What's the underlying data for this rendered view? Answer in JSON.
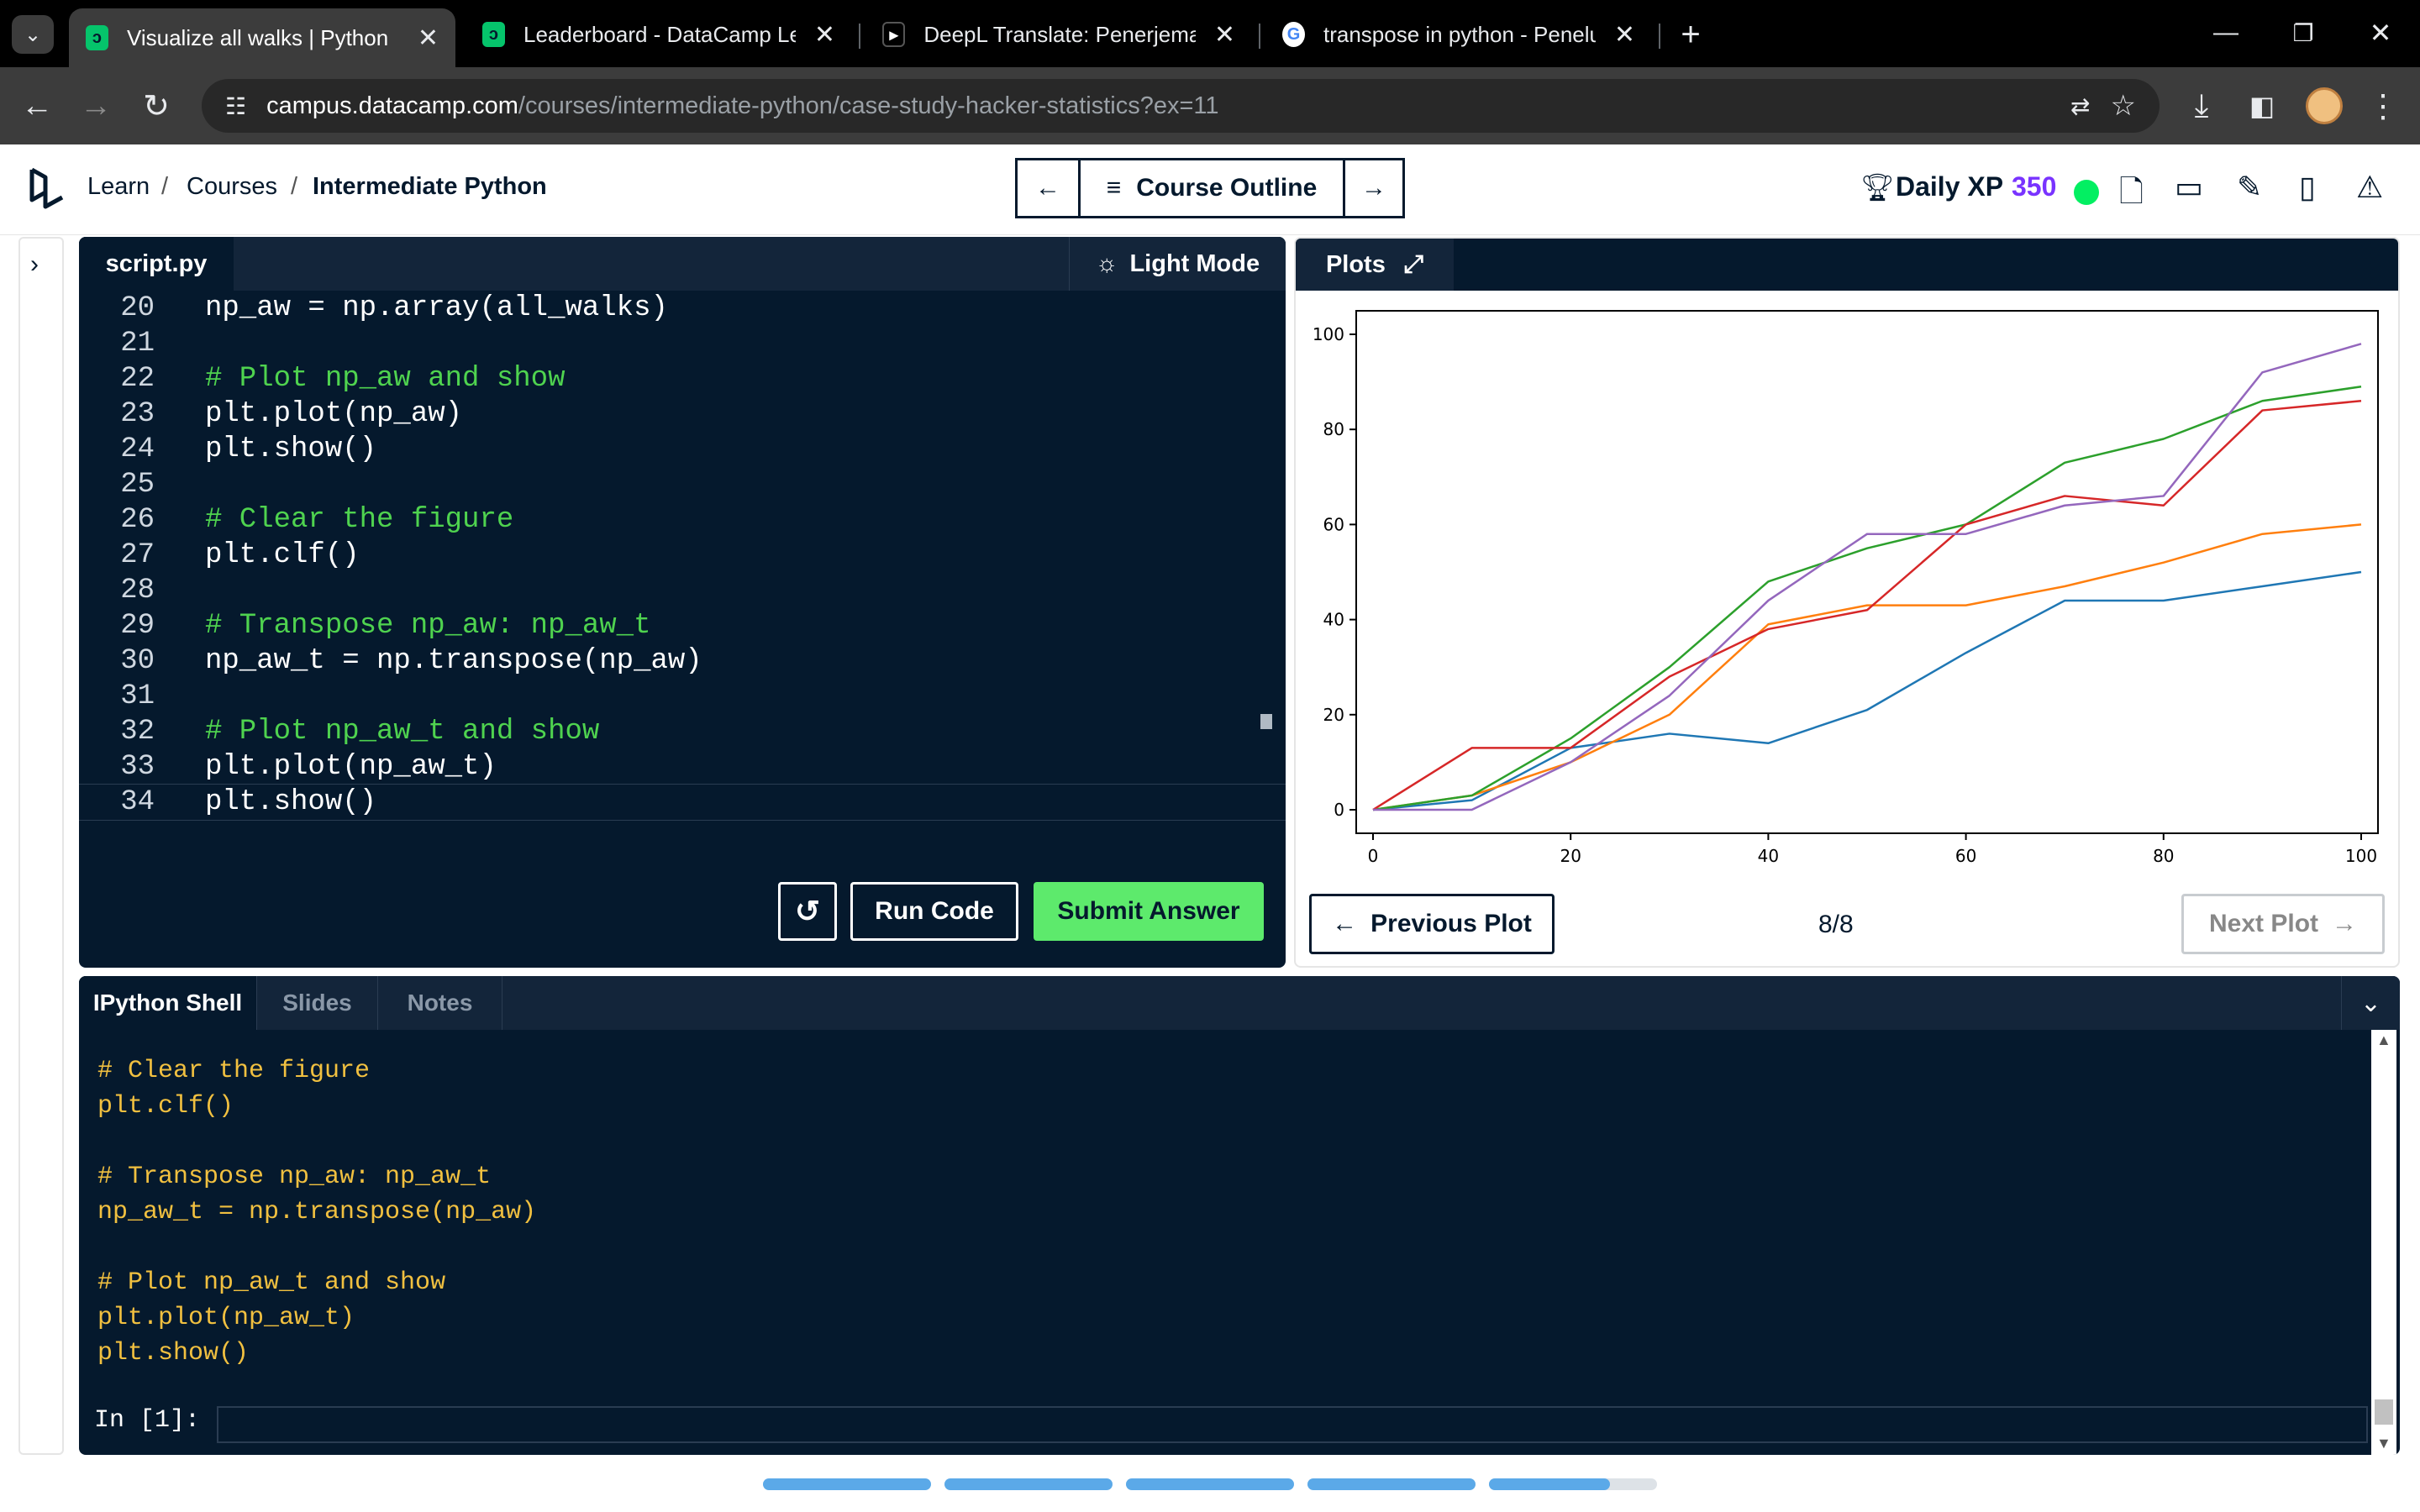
{
  "browser": {
    "tabs": [
      {
        "title": "Visualize all walks | Python",
        "favicon": "datacamp-icon",
        "active": true
      },
      {
        "title": "Leaderboard - DataCamp Learn",
        "favicon": "datacamp-icon",
        "active": false
      },
      {
        "title": "DeepL Translate: Penerjemah pa",
        "favicon": "deepl-icon",
        "active": false
      },
      {
        "title": "transpose in python - Penelusur",
        "favicon": "google-icon",
        "active": false
      }
    ],
    "url_host": "campus.datacamp.com",
    "url_path": "/courses/intermediate-python/case-study-hacker-statistics?ex=11"
  },
  "header": {
    "breadcrumb": [
      "Learn",
      "Courses",
      "Intermediate Python"
    ],
    "course_outline": "Course Outline",
    "daily_xp_label": "Daily XP",
    "daily_xp_value": "350"
  },
  "editor": {
    "filename": "script.py",
    "light_mode": "Light Mode",
    "lines": [
      {
        "n": "20",
        "text": "np_aw = np.array(all_walks)",
        "comment": false
      },
      {
        "n": "21",
        "text": "",
        "comment": false
      },
      {
        "n": "22",
        "text": "# Plot np_aw and show",
        "comment": true
      },
      {
        "n": "23",
        "text": "plt.plot(np_aw)",
        "comment": false
      },
      {
        "n": "24",
        "text": "plt.show()",
        "comment": false
      },
      {
        "n": "25",
        "text": "",
        "comment": false
      },
      {
        "n": "26",
        "text": "# Clear the figure",
        "comment": true
      },
      {
        "n": "27",
        "text": "plt.clf()",
        "comment": false
      },
      {
        "n": "28",
        "text": "",
        "comment": false
      },
      {
        "n": "29",
        "text": "# Transpose np_aw: np_aw_t",
        "comment": true
      },
      {
        "n": "30",
        "text": "np_aw_t = np.transpose(np_aw)",
        "comment": false
      },
      {
        "n": "31",
        "text": "",
        "comment": false
      },
      {
        "n": "32",
        "text": "# Plot np_aw_t and show",
        "comment": true
      },
      {
        "n": "33",
        "text": "plt.plot(np_aw_t)",
        "comment": false
      },
      {
        "n": "34",
        "text": "plt.show()",
        "comment": false
      }
    ],
    "run_code": "Run Code",
    "submit_answer": "Submit Answer"
  },
  "plots": {
    "tab_label": "Plots",
    "previous": "Previous Plot",
    "next": "Next Plot",
    "counter": "8/8"
  },
  "chart_data": {
    "type": "line",
    "xlim": [
      0,
      100
    ],
    "ylim": [
      0,
      100
    ],
    "xticks": [
      0,
      20,
      40,
      60,
      80,
      100
    ],
    "yticks": [
      0,
      20,
      40,
      60,
      80,
      100
    ],
    "x": [
      0,
      10,
      20,
      30,
      40,
      50,
      60,
      70,
      80,
      90,
      100
    ],
    "series": [
      {
        "color": "#1f77b4",
        "values": [
          0,
          2,
          13,
          16,
          14,
          21,
          33,
          44,
          44,
          47,
          50
        ]
      },
      {
        "color": "#ff7f0e",
        "values": [
          0,
          3,
          10,
          20,
          39,
          43,
          43,
          47,
          52,
          58,
          60
        ]
      },
      {
        "color": "#2ca02c",
        "values": [
          0,
          3,
          15,
          30,
          48,
          55,
          60,
          73,
          78,
          86,
          89
        ]
      },
      {
        "color": "#d62728",
        "values": [
          0,
          13,
          13,
          28,
          38,
          42,
          60,
          66,
          64,
          84,
          86
        ]
      },
      {
        "color": "#9467bd",
        "values": [
          0,
          0,
          10,
          24,
          44,
          58,
          58,
          64,
          66,
          92,
          98
        ]
      }
    ]
  },
  "shell": {
    "tabs": [
      "IPython Shell",
      "Slides",
      "Notes"
    ],
    "lines": [
      "# Clear the figure",
      "plt.clf()",
      "",
      "# Transpose np_aw: np_aw_t",
      "np_aw_t = np.transpose(np_aw)",
      "",
      "# Plot np_aw_t and show",
      "plt.plot(np_aw_t)",
      "plt.show()"
    ],
    "prompt": "In [1]:"
  }
}
